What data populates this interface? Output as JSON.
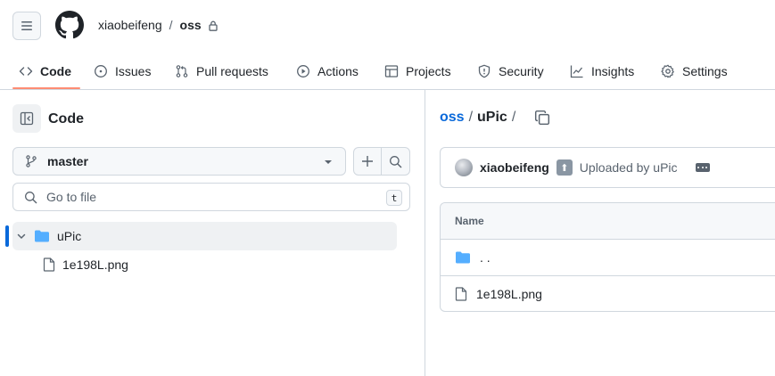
{
  "header": {
    "owner": "xiaobeifeng",
    "separator": "/",
    "repo": "oss"
  },
  "tabs": [
    {
      "label": "Code",
      "icon": "code-icon",
      "active": true
    },
    {
      "label": "Issues",
      "icon": "issue-icon"
    },
    {
      "label": "Pull requests",
      "icon": "pull-request-icon"
    },
    {
      "label": "Actions",
      "icon": "play-icon"
    },
    {
      "label": "Projects",
      "icon": "table-icon"
    },
    {
      "label": "Security",
      "icon": "shield-icon"
    },
    {
      "label": "Insights",
      "icon": "graph-icon"
    },
    {
      "label": "Settings",
      "icon": "gear-icon"
    }
  ],
  "sidebar": {
    "title": "Code",
    "branch": "master",
    "goto_placeholder": "Go to file",
    "goto_shortcut": "t",
    "tree": [
      {
        "type": "folder",
        "label": "uPic",
        "expanded": true,
        "selected": true
      },
      {
        "type": "file",
        "label": "1e198L.png"
      }
    ]
  },
  "main": {
    "path_root": "oss",
    "path_current": "uPic",
    "path_sep": "/",
    "commit": {
      "author": "xiaobeifeng",
      "emoji": "up-arrow-emoji",
      "message": "Uploaded by uPic"
    },
    "table": {
      "header": "Name",
      "rows": [
        {
          "type": "parent",
          "label": ". ."
        },
        {
          "type": "file",
          "label": "1e198L.png"
        }
      ]
    }
  },
  "colors": {
    "accent": "#0969da",
    "tab_underline": "#fd8c73",
    "folder": "#54aeff",
    "border": "#d0d7de"
  }
}
